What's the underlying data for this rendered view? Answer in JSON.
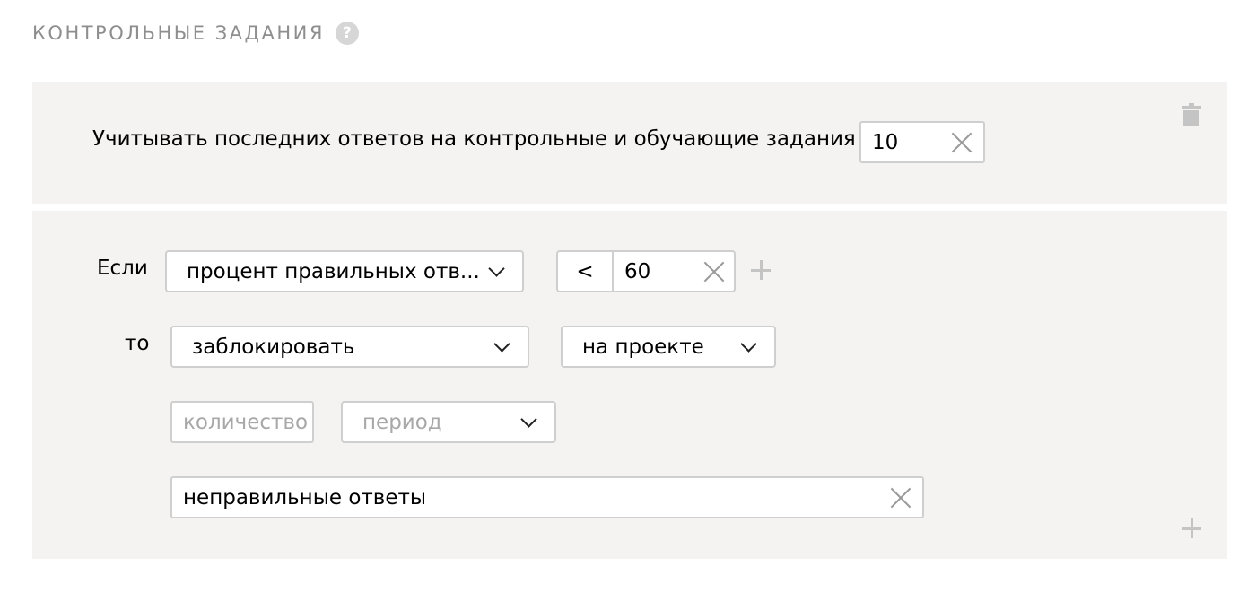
{
  "header": {
    "title": "КОНТРОЛЬНЫЕ ЗАДАНИЯ",
    "help_glyph": "?"
  },
  "history": {
    "label": "Учитывать последних ответов на контрольные и обучающие задания",
    "value": "10"
  },
  "rule": {
    "if_label": "Если",
    "condition_select": "процент правильных отв...",
    "operator": "<",
    "threshold": "60",
    "then_label": "то",
    "action_select": "заблокировать",
    "scope_select": "на проекте",
    "count_placeholder": "количество",
    "period_placeholder": "период",
    "reason_value": "неправильные ответы"
  },
  "colors": {
    "panel_bg": "#f4f3f1",
    "border": "#cfcfcf",
    "muted_text": "#8e8e8e",
    "placeholder": "#a8a8a8"
  }
}
